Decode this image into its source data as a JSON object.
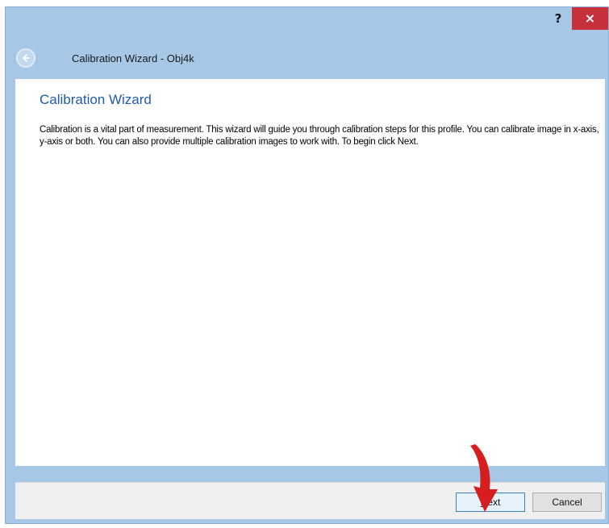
{
  "window": {
    "title": "Calibration Wizard - Obj4k",
    "help_label": "?",
    "close_label": "×",
    "frame_color": "#a7c7e6",
    "close_color": "#c7313c"
  },
  "nav": {
    "back_icon": "back-arrow-icon"
  },
  "content": {
    "heading": "Calibration Wizard",
    "heading_color": "#1f5ca6",
    "description": "Calibration is a vital part of measurement. This wizard will guide you through calibration steps for this profile. You can calibrate image in x-axis, y-axis or both. You can also provide multiple calibration images to work with. To begin click Next."
  },
  "footer": {
    "next_accel": "N",
    "next_rest": "ext",
    "cancel_label": "Cancel"
  },
  "annotation": {
    "icon": "red-arrow-icon",
    "color": "#d61e1e"
  }
}
